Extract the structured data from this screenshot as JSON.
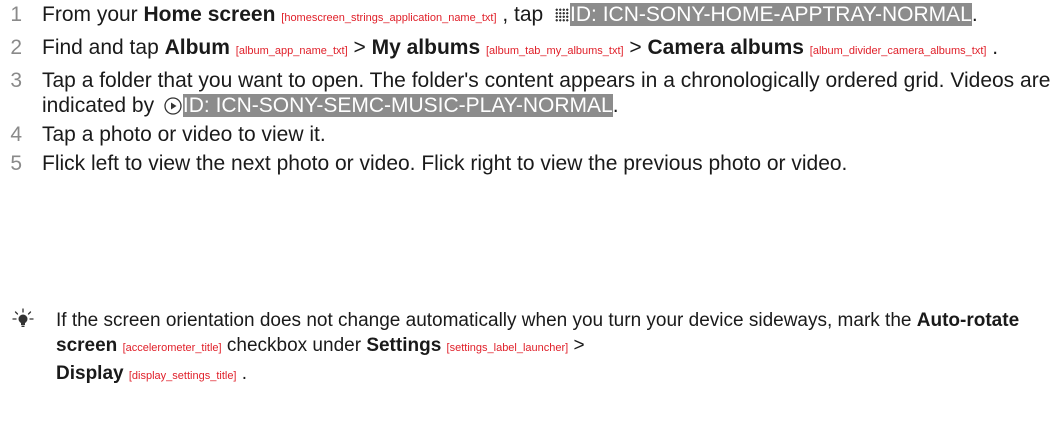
{
  "steps": [
    {
      "num": "1",
      "t1": "From your ",
      "home_screen": "Home screen",
      "home_tag": "[homescreen_strings_application_name_txt]",
      "t2": " , tap ",
      "apptray_id": "ID: ICN-SONY-HOME-APPTRAY-NORMAL",
      "t3": "."
    },
    {
      "num": "2",
      "t1": "Find and tap ",
      "album": "Album",
      "album_tag": "[album_app_name_txt]",
      "sep1": " > ",
      "my_albums": "My albums",
      "my_albums_tag": "[album_tab_my_albums_txt]",
      "sep2": " > ",
      "camera_albums": "Camera albums",
      "camera_tag": "[album_divider_camera_albums_txt]",
      "t2": " ."
    },
    {
      "num": "3",
      "t1": "Tap a folder that you want to open. The folder's content appears in a chronologically ordered grid. Videos are indicated by ",
      "play_id": "ID: ICN-SONY-SEMC-MUSIC-PLAY-NORMAL",
      "t2": "."
    },
    {
      "num": "4",
      "text": "Tap a photo or video to view it."
    },
    {
      "num": "5",
      "text": "Flick left to view the next photo or video. Flick right to view the previous photo or video."
    }
  ],
  "tip": {
    "icon": "lightbulb-icon",
    "t1": "If the screen orientation does not change automatically when you turn your device sideways, mark the ",
    "auto_rotate": "Auto-rotate screen",
    "auto_rotate_tag": "[accelerometer_title]",
    "t2": " checkbox under ",
    "settings": "Settings",
    "settings_tag": "[settings_label_launcher]",
    "sep": " > ",
    "display": "Display",
    "display_tag": "[display_settings_title]",
    "t3": " ."
  },
  "colors": {
    "tag": "#e0202a",
    "highlight_bg": "#8c8c8c",
    "number": "#8a8a8a",
    "text": "#1a1a1a"
  }
}
